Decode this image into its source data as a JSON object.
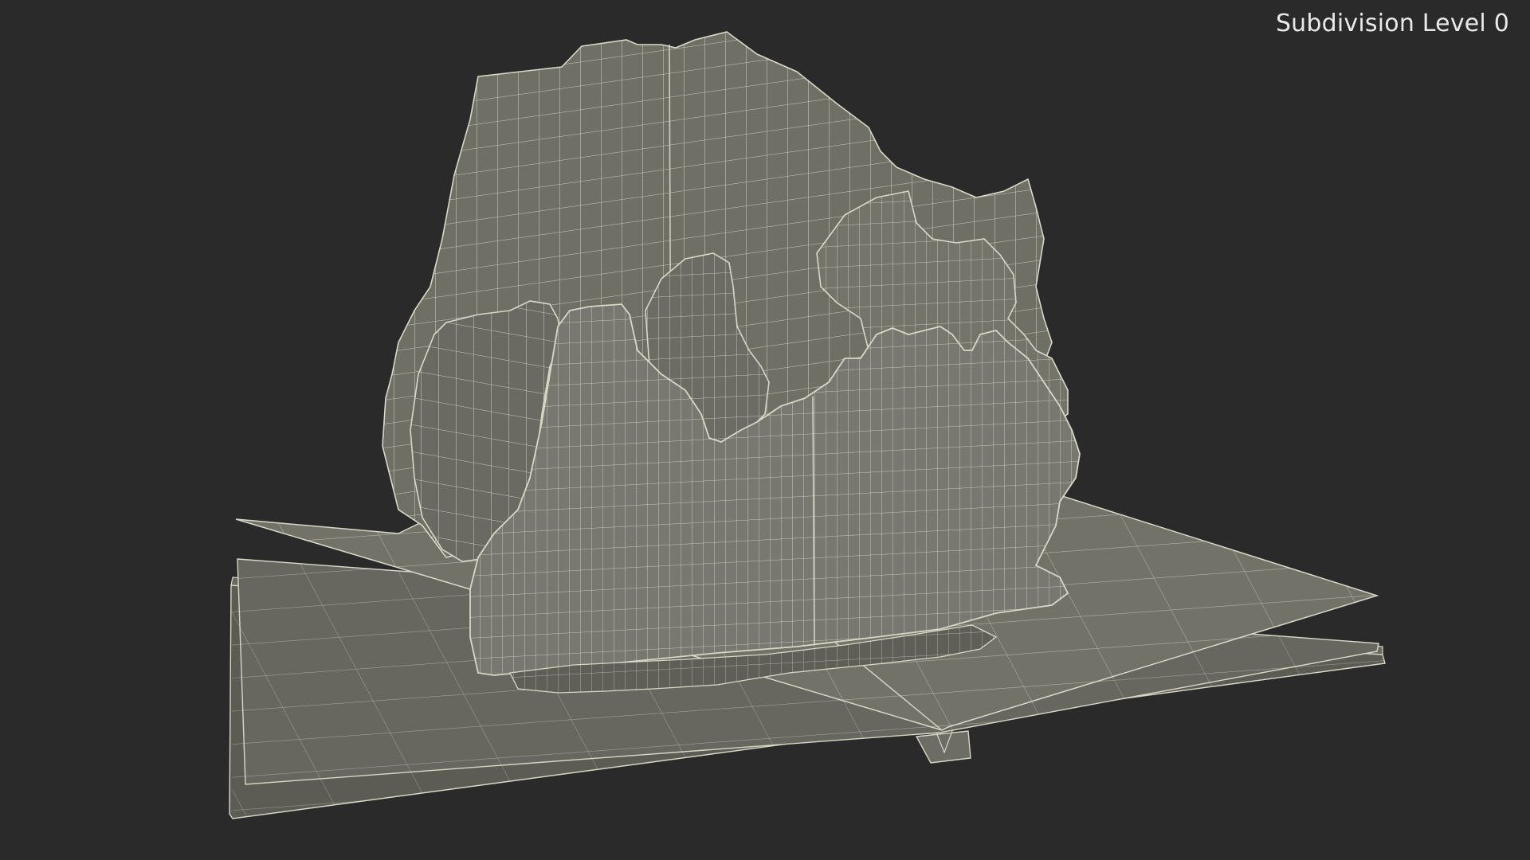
{
  "viewport": {
    "label": "Subdivision Level 0",
    "background_color": "#2a2a2a",
    "model_fill_color": "#6f6f66",
    "model_face_light": "#7a7a70",
    "model_face_dark": "#5c5c54",
    "wire_color": "#d8d8c8"
  }
}
